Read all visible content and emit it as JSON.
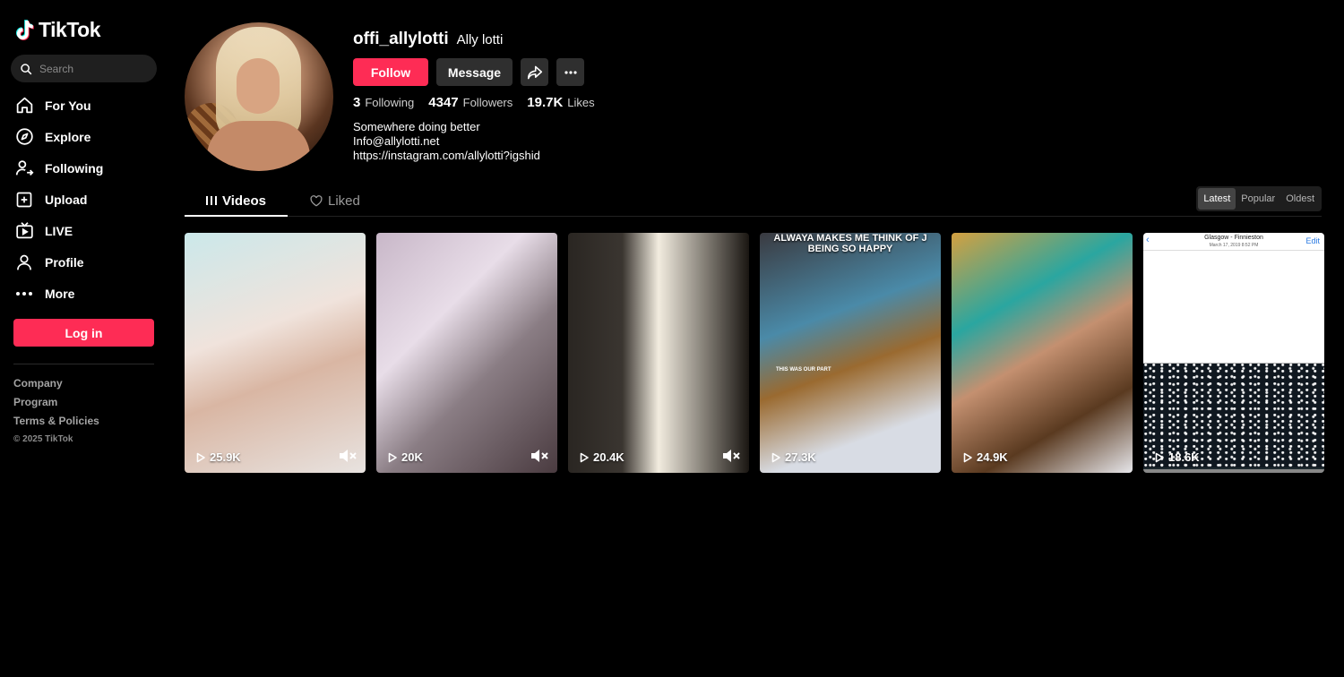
{
  "brand": {
    "name": "TikTok"
  },
  "search": {
    "placeholder": "Search"
  },
  "nav": [
    {
      "label": "For You",
      "icon": "home-icon"
    },
    {
      "label": "Explore",
      "icon": "compass-icon"
    },
    {
      "label": "Following",
      "icon": "user-follow-icon"
    },
    {
      "label": "Upload",
      "icon": "plus-square-icon"
    },
    {
      "label": "LIVE",
      "icon": "tv-icon"
    },
    {
      "label": "Profile",
      "icon": "user-icon"
    },
    {
      "label": "More",
      "icon": "more-dots-icon"
    }
  ],
  "login_label": "Log in",
  "footer": {
    "links": [
      "Company",
      "Program",
      "Terms & Policies"
    ],
    "copyright": "© 2025 TikTok"
  },
  "profile": {
    "username": "offi_allylotti",
    "display_name": "Ally lotti",
    "follow_label": "Follow",
    "message_label": "Message",
    "stats": {
      "following": {
        "value": "3",
        "label": "Following"
      },
      "followers": {
        "value": "4347",
        "label": "Followers"
      },
      "likes": {
        "value": "19.7K",
        "label": "Likes"
      }
    },
    "bio": [
      "Somewhere doing better",
      "Info@allylotti.net",
      "https://instagram.com/allylotti?igshid"
    ]
  },
  "tabs": {
    "videos": "Videos",
    "liked": "Liked"
  },
  "sort": {
    "options": [
      "Latest",
      "Popular",
      "Oldest"
    ],
    "active": "Latest"
  },
  "videos": [
    {
      "views": "25.9K",
      "muted": true
    },
    {
      "views": "20K",
      "muted": true
    },
    {
      "views": "20.4K",
      "muted": true
    },
    {
      "views": "27.3K",
      "caption": "ALWAYA MAKES ME THINK OF J BEING SO HAPPY",
      "subcaption": "THIS WAS OUR PART"
    },
    {
      "views": "24.9K"
    },
    {
      "views": "18.6K",
      "screen_title": "Glasgow - Finnieston",
      "screen_date": "March 17, 2019  8:52 PM",
      "screen_action": "Edit"
    }
  ],
  "colors": {
    "accent": "#fe2c55",
    "background": "#000000",
    "button_dark": "#2f2f2f"
  }
}
